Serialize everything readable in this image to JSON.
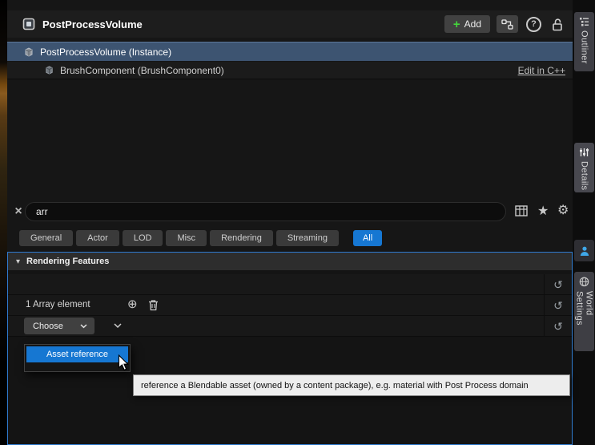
{
  "header": {
    "title": "PostProcessVolume",
    "add_label": "Add"
  },
  "icons": {
    "plus": "+",
    "help": "?",
    "clear": "×",
    "star": "★",
    "gear": "⚙",
    "undo": "↺",
    "expander": "▾",
    "circle_plus": "⊕"
  },
  "tree": {
    "rows": [
      {
        "label": "PostProcessVolume (Instance)"
      },
      {
        "label": "BrushComponent (BrushComponent0)",
        "action": "Edit in C++"
      }
    ]
  },
  "search": {
    "value": "arr"
  },
  "filters": [
    {
      "label": "General",
      "active": false
    },
    {
      "label": "Actor",
      "active": false
    },
    {
      "label": "LOD",
      "active": false
    },
    {
      "label": "Misc",
      "active": false
    },
    {
      "label": "Rendering",
      "active": false
    },
    {
      "label": "Streaming",
      "active": false
    },
    {
      "label": "All",
      "active": true
    }
  ],
  "rendering_features": {
    "section_title": "Rendering Features",
    "array_row_label": "1 Array element",
    "choose_button_label": "Choose"
  },
  "dropdown": {
    "items": [
      {
        "label": "Asset reference"
      }
    ]
  },
  "tooltip": {
    "text": "reference a Blendable asset (owned by a content package), e.g. material with Post Process domain"
  },
  "side_tabs": [
    {
      "label": "Outliner"
    },
    {
      "label": "Details"
    },
    {
      "label": "World Settings"
    }
  ],
  "colors": {
    "accent": "#1677d2",
    "selection": "#3d5471",
    "focus_border": "#2f7bd0"
  }
}
